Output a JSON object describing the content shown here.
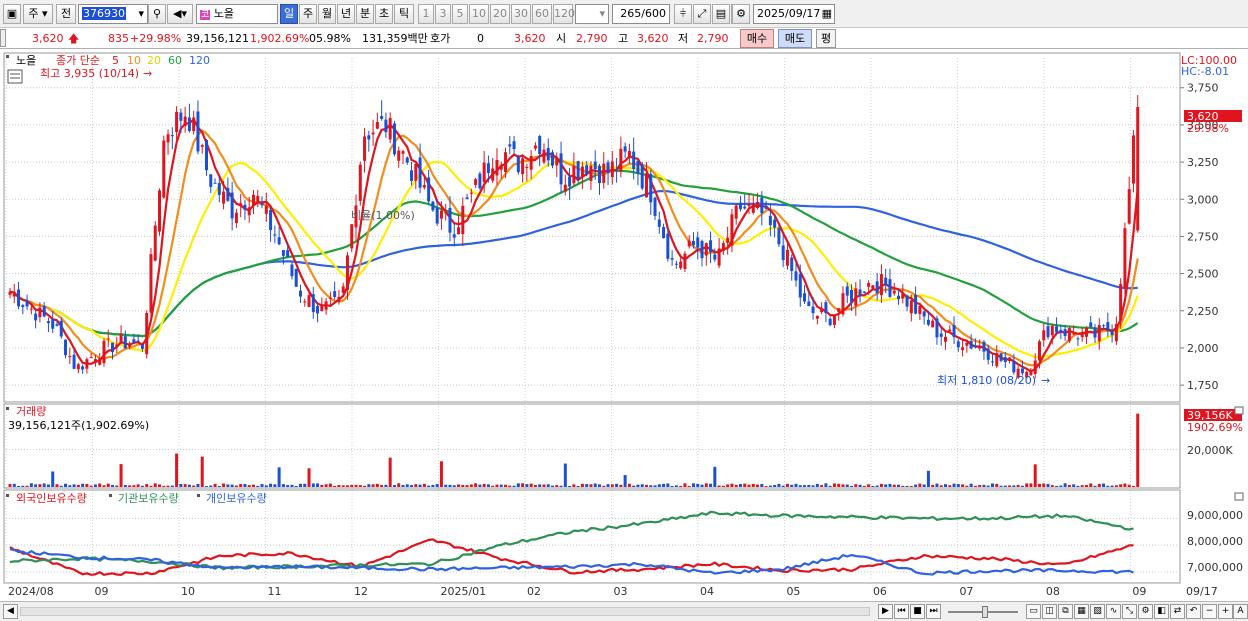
{
  "toolbar": {
    "mode_label": "주",
    "scope_label": "전",
    "code": "376930",
    "stock_name": "노을",
    "period_tabs": [
      "일",
      "주",
      "월",
      "년",
      "분",
      "초",
      "틱"
    ],
    "interval_tabs": [
      "1",
      "3",
      "5",
      "10",
      "20",
      "30",
      "60",
      "120"
    ],
    "count": "265",
    "count_total": "/600",
    "date": "2025/09/17"
  },
  "quote": {
    "price": "3,620",
    "change": "835",
    "change_pct": "+29.98%",
    "volume": "39,156,121",
    "volume_pct": "1,902.69%",
    "turnover": "05.98%",
    "amount": "131,359백만",
    "hoga_label": "호가",
    "hoga_value": "0",
    "hoga_price": "3,620",
    "open_label": "시",
    "open_value": "2,790",
    "high_label": "고",
    "high_value": "3,620",
    "low_label": "저",
    "low_value": "2,790",
    "buy_label": "매수",
    "sell_label": "매도",
    "avg_label": "평"
  },
  "legend": {
    "tag": "노을",
    "ma_title": "종가 단순",
    "ma_periods": [
      "5",
      "10",
      "20",
      "60",
      "120"
    ],
    "high_note": "최고 3,935 (10/14)",
    "low_note": "최저 1,810 (08/20)",
    "lc": "LC:100.00",
    "hc": "HC:-8.01",
    "overlay_note": "비율(1.00%)",
    "current_price_tag": "3,620",
    "current_pct_tag": "29.98%"
  },
  "volume_pane": {
    "title": "거래량",
    "summary": "39,156,121주(1,902.69%)",
    "tag_value": "39,156K",
    "tag_pct": "1902.69%",
    "axis_label": "20,000K"
  },
  "holdings_pane": {
    "legends": [
      "외국인보유수량",
      "기관보유수량",
      "개인보유수량"
    ],
    "axis_labels": [
      "9,000,000",
      "8,000,000",
      "7,000,000"
    ]
  },
  "x_axis": {
    "labels": [
      "2024/08",
      "09",
      "10",
      "11",
      "12",
      "2025/01",
      "02",
      "03",
      "04",
      "05",
      "06",
      "07",
      "08",
      "09"
    ],
    "end_label": "09/17"
  },
  "colors": {
    "up": "#e0141e",
    "down": "#1a4fd6",
    "ma5": "#e0141e",
    "ma10": "#f28c1a",
    "ma20": "#ffee00",
    "ma60": "#22a03c",
    "ma120": "#2f62e0",
    "foreign": "#e0141e",
    "institution": "#2f8f57",
    "individual": "#2f62e0"
  },
  "chart_data": [
    {
      "type": "candlestick",
      "title": "노을",
      "x_start": "2024/08",
      "x_end": "2025/09/17",
      "y_ticks": [
        3750,
        3500,
        3250,
        3000,
        2750,
        2500,
        2250,
        2000,
        1750
      ],
      "ylim": [
        1650,
        3950
      ],
      "ma_periods": [
        5,
        10,
        20,
        60,
        120
      ],
      "close_path": [
        [
          "2024/08",
          2380
        ],
        [
          "2024/08",
          2260
        ],
        [
          "2024/08",
          2150
        ],
        [
          "2024/09",
          1860
        ],
        [
          "2024/09",
          1980
        ],
        [
          "2024/09",
          2040
        ],
        [
          "2024/10",
          2020
        ],
        [
          "2024/10",
          3450
        ],
        [
          "2024/10",
          3600
        ],
        [
          "2024/10",
          3150
        ],
        [
          "2024/11",
          2930
        ],
        [
          "2024/11",
          3050
        ],
        [
          "2024/11",
          2760
        ],
        [
          "2024/11",
          2400
        ],
        [
          "2024/11",
          2250
        ],
        [
          "2024/12",
          2300
        ],
        [
          "2024/12",
          3450
        ],
        [
          "2024/12",
          3500
        ],
        [
          "2024/12",
          3250
        ],
        [
          "2024/12",
          2950
        ],
        [
          "2024/12",
          2800
        ],
        [
          "2025/01",
          3050
        ],
        [
          "2025/01",
          3350
        ],
        [
          "2025/01",
          3250
        ],
        [
          "2025/01",
          3400
        ],
        [
          "2025/02",
          3150
        ],
        [
          "2025/02",
          3250
        ],
        [
          "2025/02",
          3180
        ],
        [
          "2025/03",
          3300
        ],
        [
          "2025/03",
          3050
        ],
        [
          "2025/03",
          2550
        ],
        [
          "2025/03",
          2700
        ],
        [
          "2025/04",
          2580
        ],
        [
          "2025/04",
          2950
        ],
        [
          "2025/04",
          2900
        ],
        [
          "2025/04",
          2650
        ],
        [
          "2025/05",
          2250
        ],
        [
          "2025/05",
          2200
        ],
        [
          "2025/05",
          2350
        ],
        [
          "2025/06",
          2450
        ],
        [
          "2025/06",
          2400
        ],
        [
          "2025/06",
          2250
        ],
        [
          "2025/07",
          2100
        ],
        [
          "2025/07",
          2050
        ],
        [
          "2025/07",
          2000
        ],
        [
          "2025/08",
          1900
        ],
        [
          "2025/08",
          1850
        ],
        [
          "2025/08",
          2150
        ],
        [
          "2025/08",
          2100
        ],
        [
          "2025/09",
          2080
        ],
        [
          "2025/09",
          2150
        ],
        [
          "2025/09/17",
          3620
        ]
      ]
    },
    {
      "type": "bar",
      "title": "거래량",
      "unit": "K",
      "y_ticks": [
        20000
      ],
      "last_value": 39156
    },
    {
      "type": "line",
      "title": "보유수량",
      "y_ticks": [
        9000000,
        8000000,
        7000000
      ],
      "series": [
        {
          "name": "외국인보유수량",
          "values": [
            7900000,
            6950000,
            6950000,
            7600000,
            7700000,
            7200000,
            8200000,
            7500000,
            7000000,
            7100000,
            7300000,
            7050000,
            7100000,
            7600000,
            7500000,
            7250000,
            8000000
          ]
        },
        {
          "name": "기관보유수량",
          "values": [
            7400000,
            7500000,
            7400000,
            7150000,
            7200000,
            7250000,
            7300000,
            8000000,
            8500000,
            8800000,
            9200000,
            9100000,
            9050000,
            9000000,
            9000000,
            9100000,
            8600000
          ]
        },
        {
          "name": "개인보유수량",
          "values": [
            7800000,
            7550000,
            7450000,
            7150000,
            7200000,
            7150000,
            7100000,
            7150000,
            7200000,
            7300000,
            6950000,
            7100000,
            7650000,
            6950000,
            7050000,
            7050000,
            7000000
          ]
        }
      ]
    }
  ]
}
